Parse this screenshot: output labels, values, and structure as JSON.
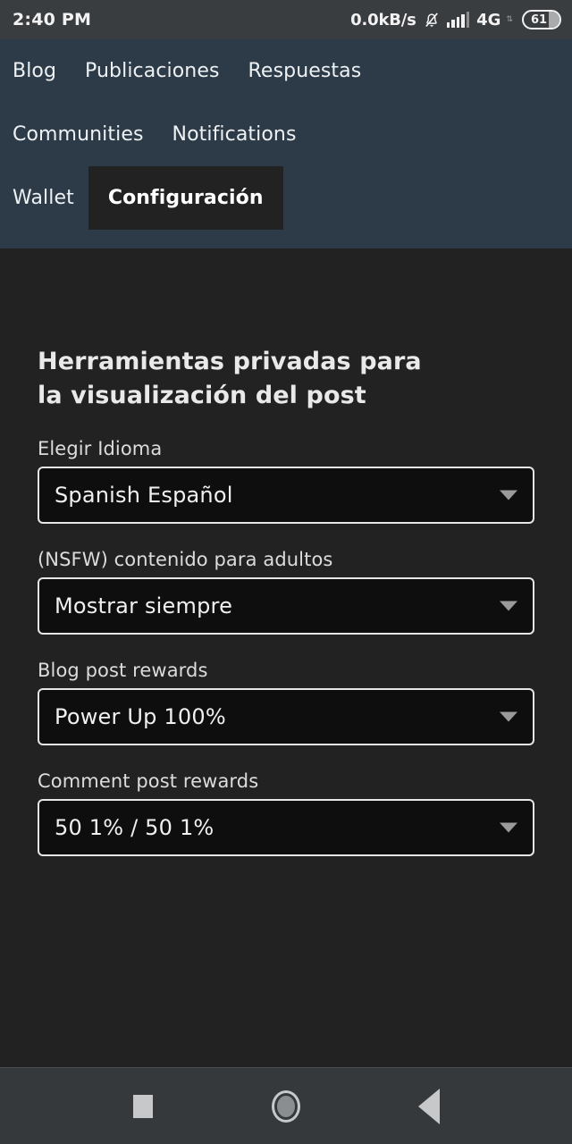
{
  "status_bar": {
    "clock": "2:40 PM",
    "net_speed": "0.0kB/s",
    "bell_icon": "bell-muted-icon",
    "signal_icon": "signal-bars-icon",
    "network_type": "4G",
    "data_arrows": "↕",
    "battery_level": "61"
  },
  "topnav": {
    "rows": [
      [
        {
          "label": "Blog",
          "active": false
        },
        {
          "label": "Publicaciones",
          "active": false
        },
        {
          "label": "Respuestas",
          "active": false
        }
      ],
      [
        {
          "label": "Communities",
          "active": false
        },
        {
          "label": "Notifications",
          "active": false
        }
      ],
      [
        {
          "label": "Wallet",
          "active": false
        },
        {
          "label": "Configuración",
          "active": true
        }
      ]
    ],
    "background_color": "#2d3b49",
    "active_tab_color": "#222222"
  },
  "main": {
    "title": "Herramientas privadas para la visualización del post",
    "fields": [
      {
        "label": "Elegir Idioma",
        "value": "Spanish Español",
        "caret_icon": "chevron-down-icon"
      },
      {
        "label": "(NSFW) contenido para adultos",
        "value": "Mostrar siempre",
        "caret_icon": "chevron-down-icon"
      },
      {
        "label": "Blog post rewards",
        "value": "Power Up 100%",
        "caret_icon": "chevron-down-icon"
      },
      {
        "label": "Comment post rewards",
        "value": "50 1% / 50 1%",
        "caret_icon": "chevron-down-icon"
      }
    ]
  },
  "system_nav": {
    "recents_icon": "square-recents-icon",
    "home_icon": "circle-home-icon",
    "back_icon": "triangle-back-icon"
  }
}
